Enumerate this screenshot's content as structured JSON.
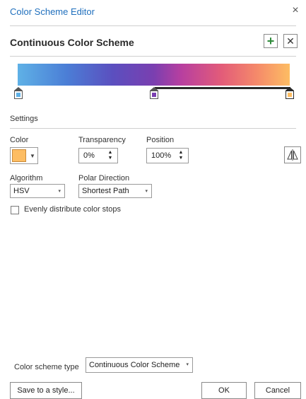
{
  "window": {
    "title": "Color Scheme Editor",
    "close_glyph": "×"
  },
  "header": {
    "scheme_title": "Continuous Color Scheme",
    "add_glyph": "+",
    "remove_glyph": "✕"
  },
  "gradient": {
    "stops": [
      {
        "position_percent": 0,
        "color": "#5fb1e6"
      },
      {
        "position_percent": 50,
        "color": "#7a3fb0"
      },
      {
        "position_percent": 100,
        "color": "#fdbd63"
      }
    ],
    "selected_stop_index": 2
  },
  "settings": {
    "section_label": "Settings",
    "color": {
      "label": "Color",
      "value": "#fdbd63",
      "dropdown_glyph": "▼"
    },
    "transparency": {
      "label": "Transparency",
      "value": "0%"
    },
    "position": {
      "label": "Position",
      "value": "100%"
    },
    "spin_glyphs": {
      "up": "▲",
      "down": "▼"
    },
    "algorithm": {
      "label": "Algorithm",
      "value": "HSV"
    },
    "polar_direction": {
      "label": "Polar Direction",
      "value": "Shortest Path"
    },
    "combo_caret": "▾",
    "evenly_distribute": {
      "label": "Evenly distribute color stops",
      "checked": false
    }
  },
  "footer": {
    "scheme_type_label": "Color scheme type",
    "scheme_type_value": "Continuous Color Scheme",
    "save_label": "Save to a style...",
    "ok_label": "OK",
    "cancel_label": "Cancel"
  }
}
